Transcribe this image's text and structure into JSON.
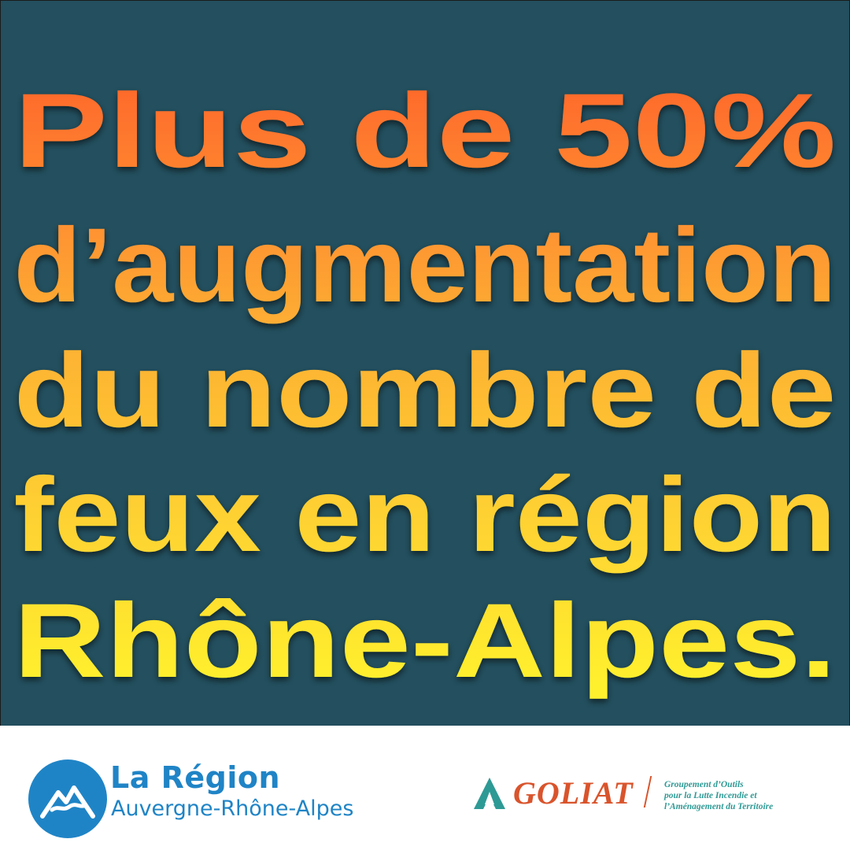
{
  "headline": {
    "lines": [
      "Plus de 50%",
      "d’augmentation",
      "du nombre de",
      "feux en région",
      "Rhône-Alpes."
    ]
  },
  "colors": {
    "background": "#234f5e",
    "gradient_top": "#ff5a2a",
    "gradient_mid": "#fdae34",
    "gradient_bottom": "#fff02e",
    "region_blue": "#1f84c6",
    "goliat_red": "#d9542c",
    "goliat_teal": "#2e9a95"
  },
  "footer": {
    "region_logo": {
      "title": "La Région",
      "subtitle": "Auvergne-Rhône-Alpes",
      "icon": "region-mountain-icon"
    },
    "goliat_logo": {
      "name": "GOLIAT",
      "icon": "goliat-flame-icon",
      "description_lines": [
        "Groupement d’Outils",
        "pour la Lutte Incendie et",
        "l’Aménagement du Territoire"
      ]
    }
  }
}
